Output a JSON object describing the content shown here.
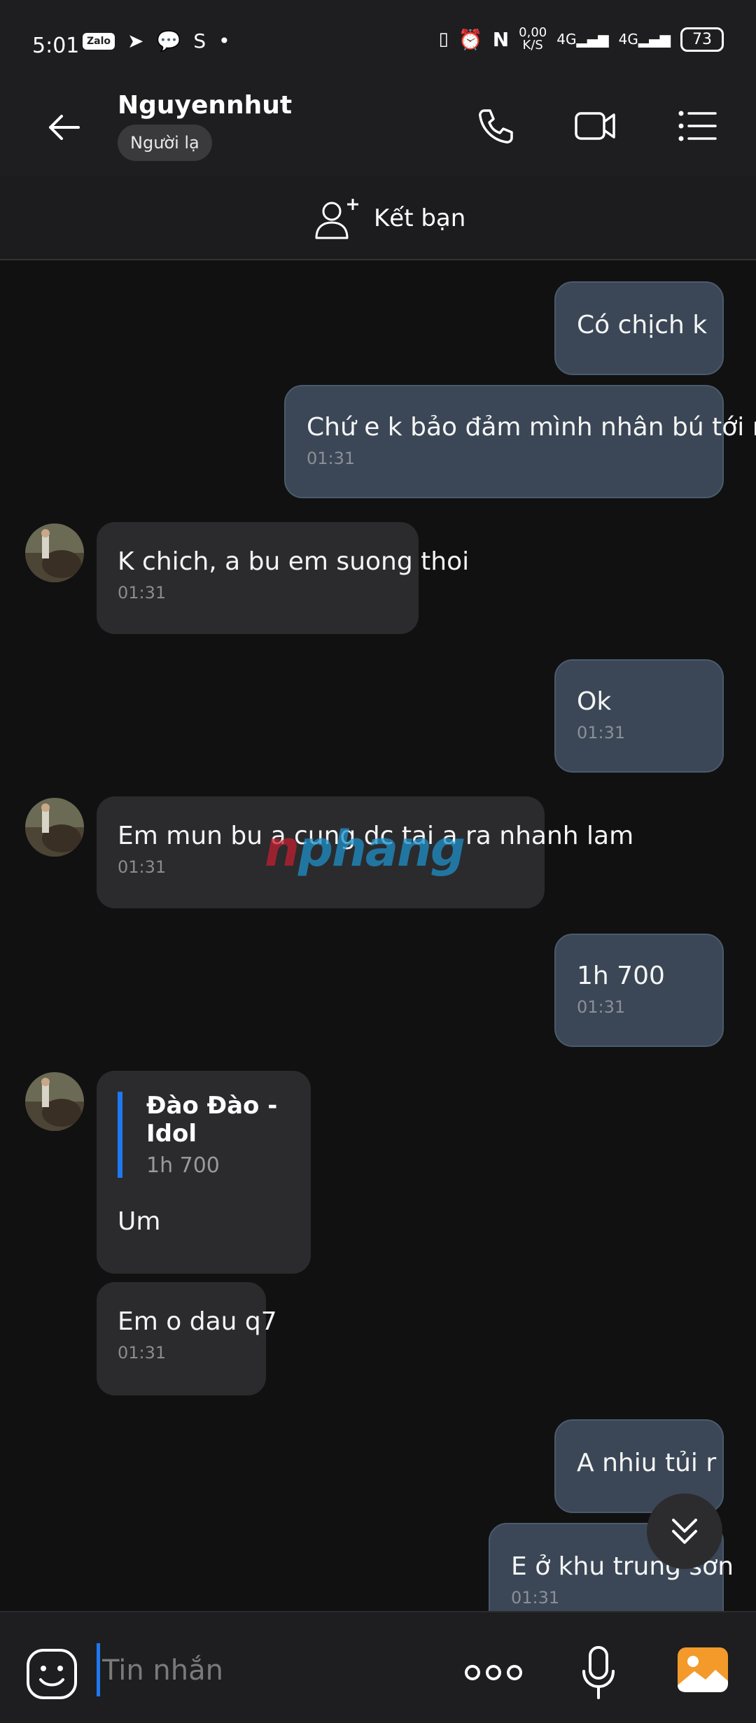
{
  "status_bar": {
    "time": "5:01",
    "app_icons": [
      "zalo-icon",
      "telegram-icon",
      "messenger-icon",
      "s-app-icon",
      "dot-icon"
    ],
    "zalo_label": "Zalo",
    "data_speed": "0,00",
    "data_unit": "K/S",
    "network1": "4G",
    "network2": "4G",
    "battery": "73"
  },
  "header": {
    "contact_name": "Nguyennhut",
    "badge": "Người lạ"
  },
  "friend_bar": {
    "label": "Kết bạn"
  },
  "messages": [
    {
      "side": "me",
      "text": "Có chịch k",
      "time": ""
    },
    {
      "side": "me",
      "text": "Chứ e k bảo đảm mình nhân bú tới ra",
      "time": "01:31"
    },
    {
      "side": "them",
      "text": "K chich, a bu em suong thoi",
      "time": "01:31"
    },
    {
      "side": "me",
      "text": "Ok",
      "time": "01:31"
    },
    {
      "side": "them",
      "text": "Em mun bu a cung dc tai a ra nhanh lam",
      "time": "01:31"
    },
    {
      "side": "me",
      "text": "1h 700",
      "time": "01:31"
    },
    {
      "side": "them",
      "quote_author": "Đào Đào - Idol",
      "quote_text": "1h 700",
      "text": "Um",
      "time": ""
    },
    {
      "side": "them",
      "text": "Em o dau q7",
      "time": "01:31"
    },
    {
      "side": "me",
      "text": "A nhiu tủi r",
      "time": ""
    },
    {
      "side": "me",
      "text": "E ở khu trung sơn",
      "time": "01:31"
    }
  ],
  "watermark": {
    "part1": "n",
    "part2": "phang"
  },
  "input": {
    "placeholder": "Tin nhắn"
  },
  "colors": {
    "my_bubble": "#3b4756",
    "their_bubble": "#2b2b2d",
    "accent": "#1e78f0",
    "image_button": "#f39a2b"
  }
}
